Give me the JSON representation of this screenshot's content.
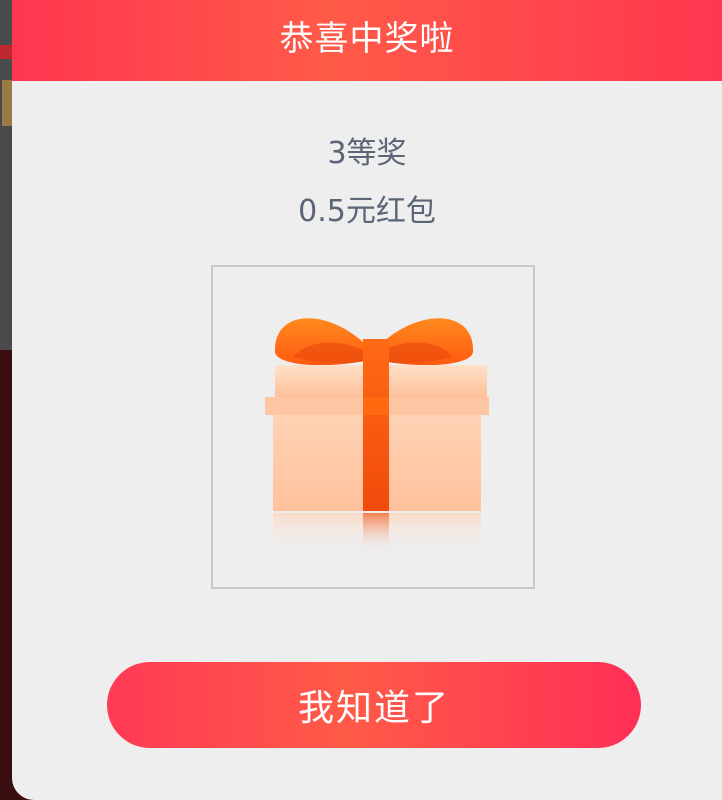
{
  "modal": {
    "title": "恭喜中奖啦",
    "prize_level": "3等奖",
    "prize_name": "0.5元红包",
    "prize_icon": "gift-box-icon",
    "confirm_label": "我知道了"
  },
  "colors": {
    "header_gradient": [
      "#ff3650",
      "#ff5a48",
      "#ff3650"
    ],
    "button_gradient": [
      "#ff3a55",
      "#ff5a48",
      "#ff2f56"
    ],
    "body_background": "#eeeeee",
    "prize_text": "#5b6577"
  }
}
